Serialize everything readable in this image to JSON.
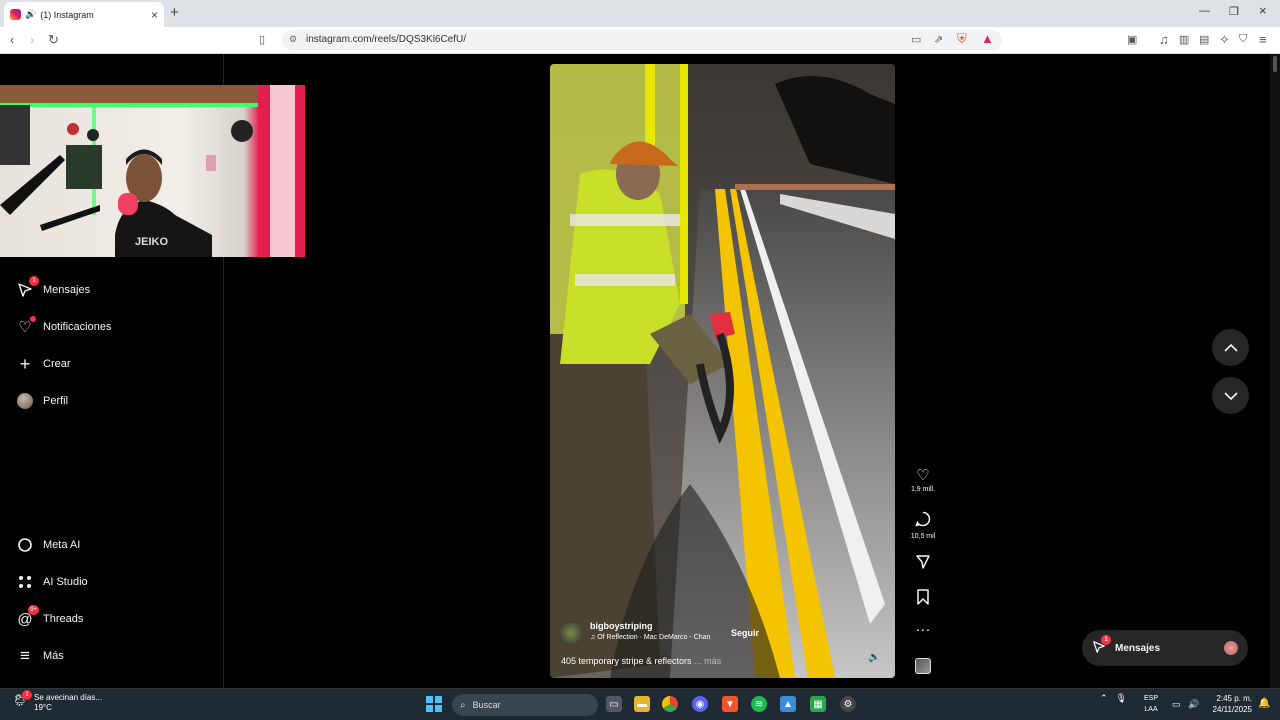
{
  "browser": {
    "tab_title": "(1) Instagram",
    "new_tab": "+",
    "url": "instagram.com/reels/DQS3Kl6CefU/",
    "window_controls": [
      "minimize",
      "restore",
      "close"
    ]
  },
  "sidebar": {
    "items": [
      {
        "label": "Mensajes",
        "icon": "messages-icon",
        "badge": "1"
      },
      {
        "label": "Notificaciones",
        "icon": "heart-icon",
        "dot": true
      },
      {
        "label": "Crear",
        "icon": "plus-icon"
      },
      {
        "label": "Perfil",
        "icon": "avatar"
      },
      {
        "label": "Meta AI",
        "icon": "meta-ai-icon"
      },
      {
        "label": "AI Studio",
        "icon": "ai-studio-icon"
      },
      {
        "label": "Threads",
        "icon": "threads-icon",
        "badge": "9+"
      },
      {
        "label": "Más",
        "icon": "menu-icon"
      }
    ]
  },
  "reel": {
    "username": "bigboystriping",
    "song": "Of Reflection · Mac DeMarco - Chan",
    "follow_label": "Seguir",
    "description": "405 temporary stripe & reflectors",
    "more_label": "... más",
    "actions": {
      "likes": "1,9 mill.",
      "comments": "10,5 mil"
    }
  },
  "messages_pill": {
    "label": "Mensajes",
    "badge": "1"
  },
  "taskbar": {
    "weather_title": "Se avecinan días...",
    "weather_temp": "19°C",
    "weather_badge": "1",
    "search_placeholder": "Buscar",
    "lang_top": "ESP",
    "lang_bottom": "LAA",
    "time": "2:45 p. m.",
    "date": "24/11/2025"
  },
  "colors": {
    "accent_badge": "#ff3040",
    "background": "#000000",
    "surface": "#262626"
  }
}
